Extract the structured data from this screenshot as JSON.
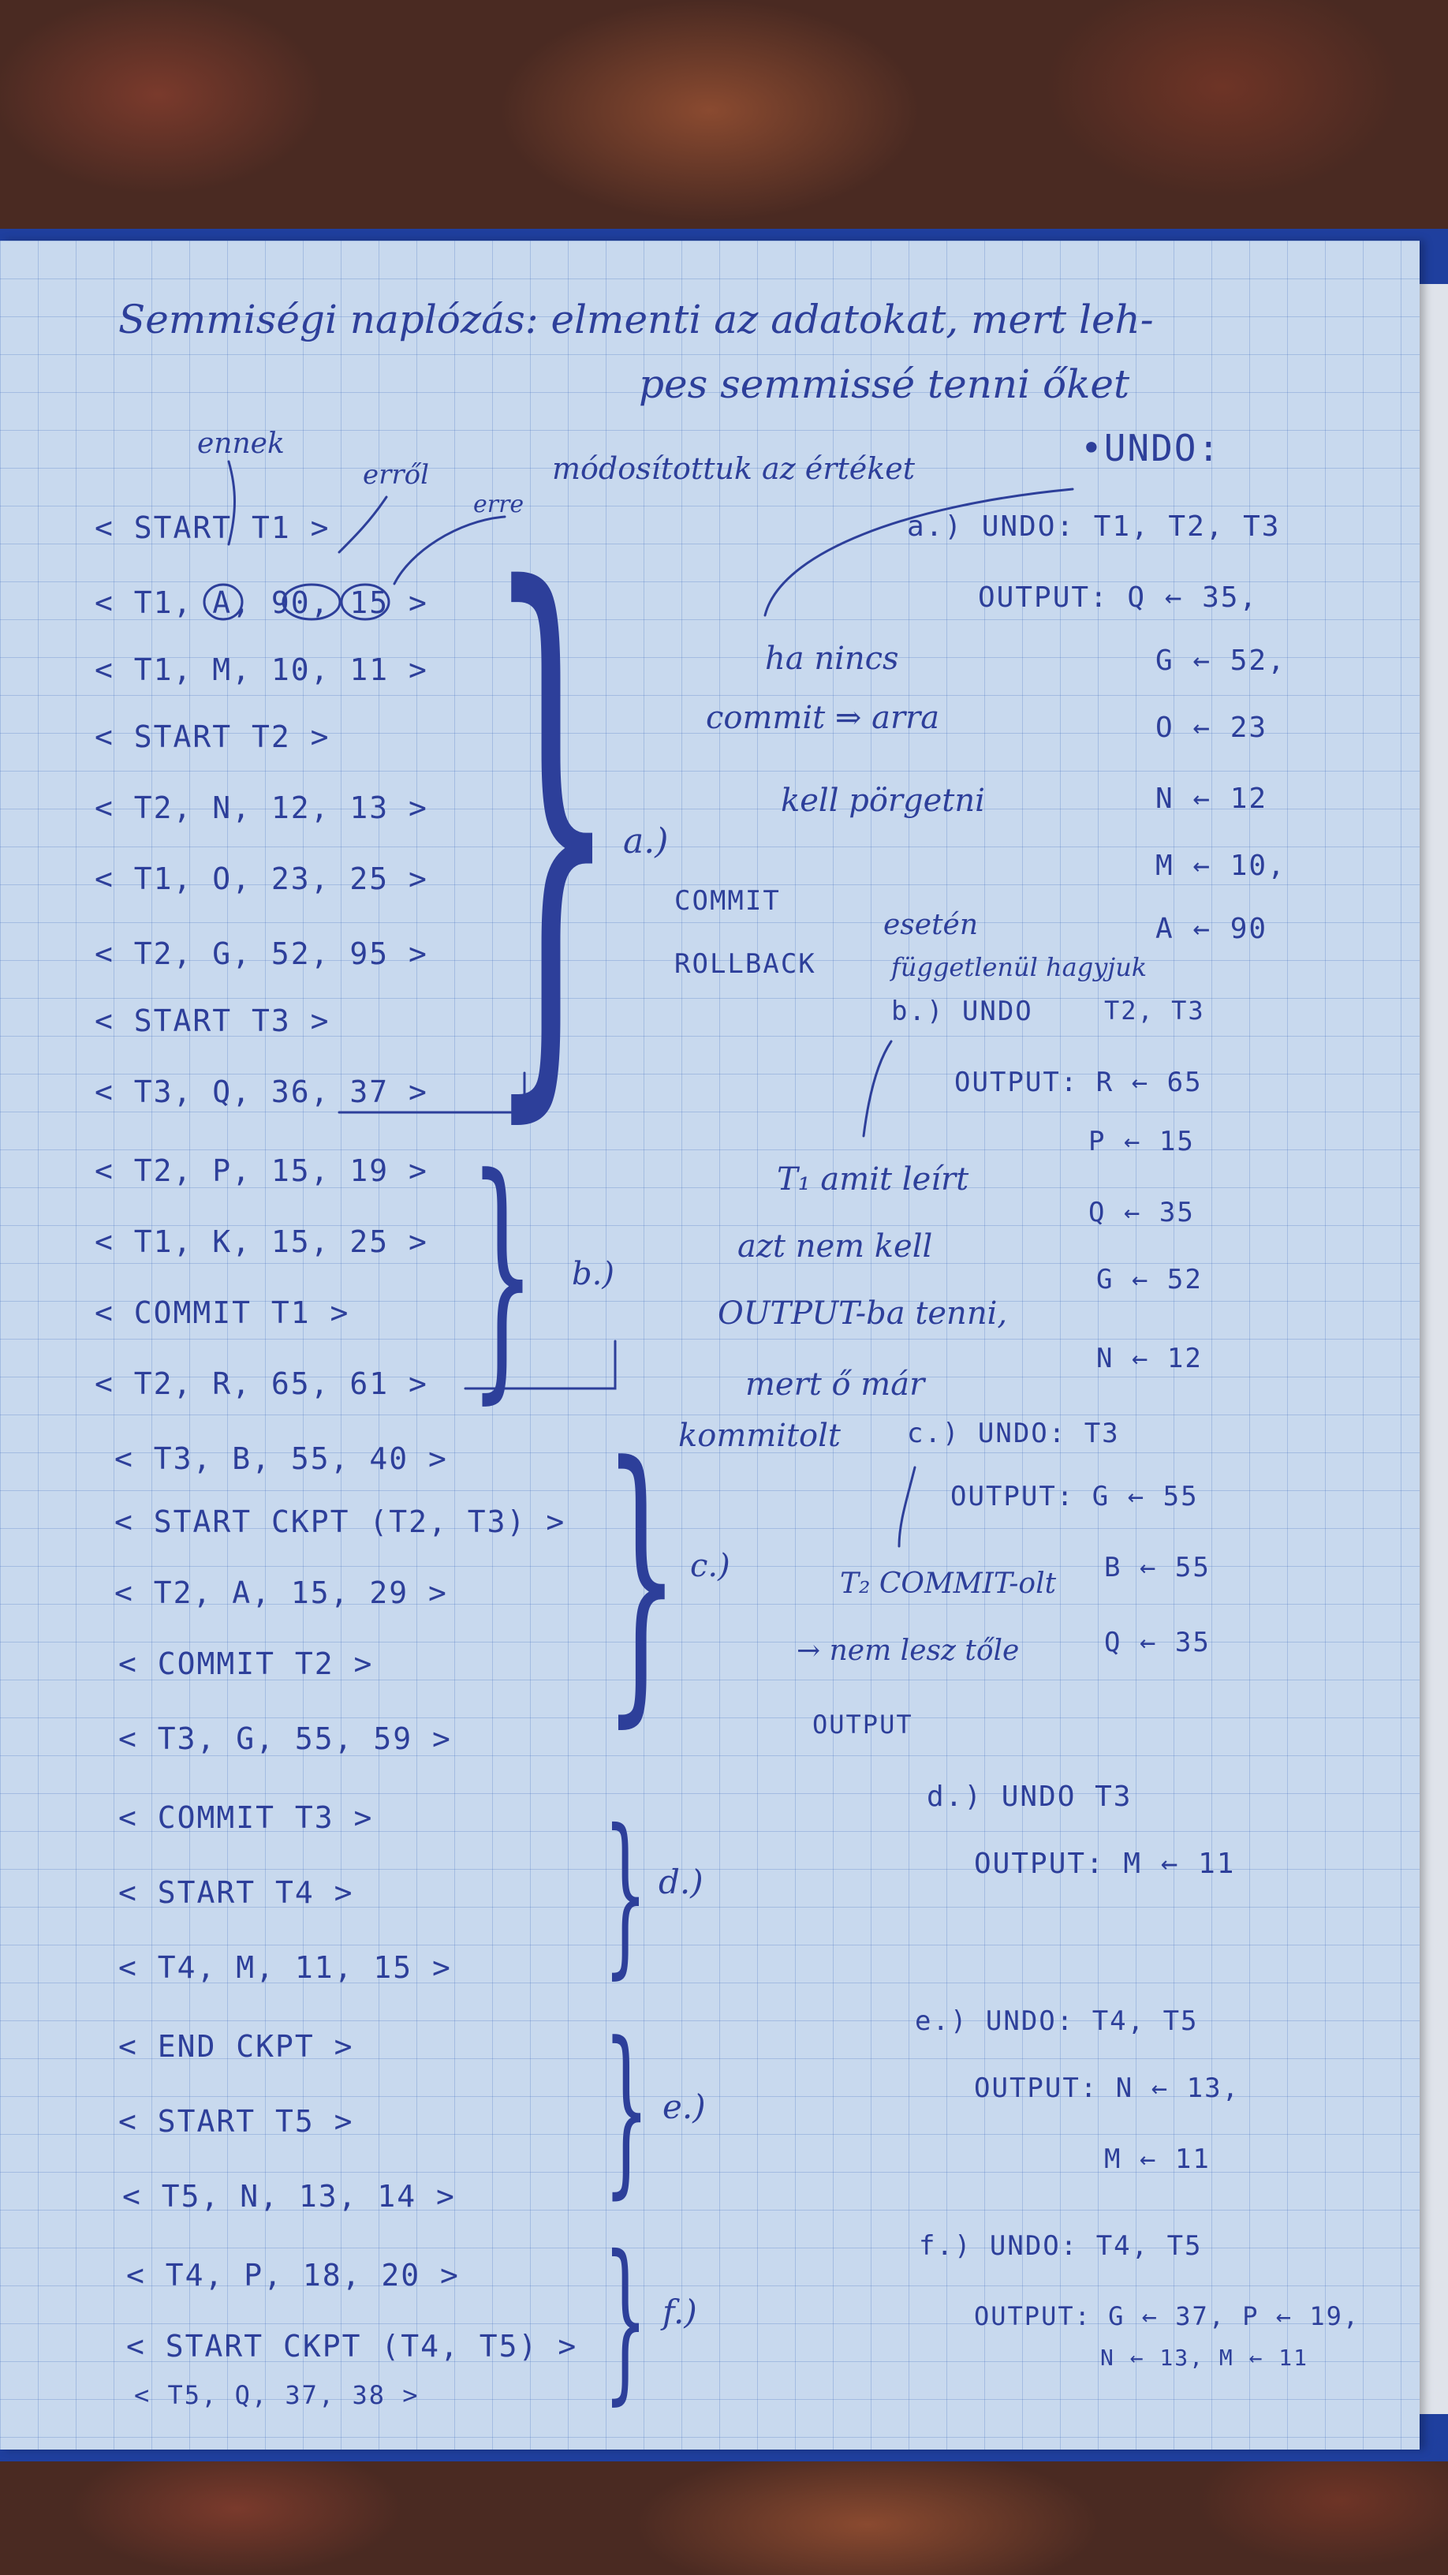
{
  "title": {
    "line1": "Semmiségi naplózás: elmenti az adatokat, mert leh-",
    "line2": "pes semmissé tenni őket"
  },
  "annotations": {
    "ennek": "ennek",
    "errol": "erről",
    "erre": "erre",
    "modositottuk": "módosítottuk az értéket",
    "undo": "•UNDO:",
    "ha_nincs": "ha nincs",
    "commit_arrow": "commit ⇒ arra",
    "kell_porgetni": "kell pörgetni",
    "commit": "COMMIT",
    "rollback": "ROLLBACK",
    "esetten": "esetén",
    "fuggetlenul": "függetlenül hagyjuk",
    "t1_amit": "T₁ amit leírt",
    "azt_nem_kell": "azt nem kell",
    "output_ba": "OUTPUT-ba tenni,",
    "mert_o_mar": "mert ő már",
    "kommitolt": "kommitolt",
    "t2_commit": "T₂ COMMIT-olt",
    "nem_lesz": "→ nem lesz tőle",
    "output_word": "OUTPUT"
  },
  "log": [
    "< START T1 >",
    "< T1, A, 90, 15 >",
    "< T1, M, 10, 11 >",
    "< START T2 >",
    "< T2, N, 12, 13 >",
    "< T1, O, 23, 25 >",
    "< T2, G, 52, 95 >",
    "< START T3 >",
    "< T3, Q, 36, 37 >",
    "< T2, P, 15, 19 >",
    "< T1, K, 15, 25 >",
    "< COMMIT T1 >",
    "< T2, R, 65, 61 >",
    "< T3, B, 55, 40 >",
    "< START CKPT (T2, T3) >",
    "< T2, A, 15, 29 >",
    "< COMMIT T2 >",
    "< T3, G, 55, 59 >",
    "< COMMIT T3 >",
    "< START T4 >",
    "< T4, M, 11, 15 >",
    "< END CKPT >",
    "< START T5 >",
    "< T5, N, 13, 14 >",
    "< T4, P, 18, 20 >",
    "< START CKPT (T4, T5) >",
    "< T5, Q, 37, 38 >"
  ],
  "braces": {
    "a": "a.)",
    "b": "b.)",
    "c": "c.)",
    "d": "d.)",
    "e": "e.)",
    "f": "f.)"
  },
  "answers": {
    "a_head": "a.) UNDO: T1, T2, T3",
    "a_lines": [
      "OUTPUT: Q ← 35,",
      "G ← 52,",
      "O ← 23",
      "N ← 12",
      "M ← 10,",
      "A ← 90"
    ],
    "b_head": "b.) UNDO",
    "b_sub": "T2, T3",
    "b_lines": [
      "OUTPUT: R ← 65",
      "P ← 15",
      "Q ← 35",
      "G ← 52",
      "N ← 12"
    ],
    "c_head": "c.) UNDO: T3",
    "c_lines": [
      "OUTPUT: G ← 55",
      "B ← 55",
      "Q ← 35"
    ],
    "d_head": "d.) UNDO T3",
    "d_lines": [
      "OUTPUT: M ← 11"
    ],
    "e_head": "e.) UNDO: T4, T5",
    "e_lines": [
      "OUTPUT: N ← 13,",
      "M ← 11"
    ],
    "f_head": "f.) UNDO: T4, T5",
    "f_lines": [
      "OUTPUT: G ← 37, P ← 19,",
      "N ← 13, M ← 11"
    ]
  },
  "colors": {
    "ink": "#2d3f9a",
    "paper": "#c8d9ee",
    "folder": "#1f3f9e",
    "tab_green": "#7fc23a",
    "tab_pink": "#f07aa0"
  }
}
